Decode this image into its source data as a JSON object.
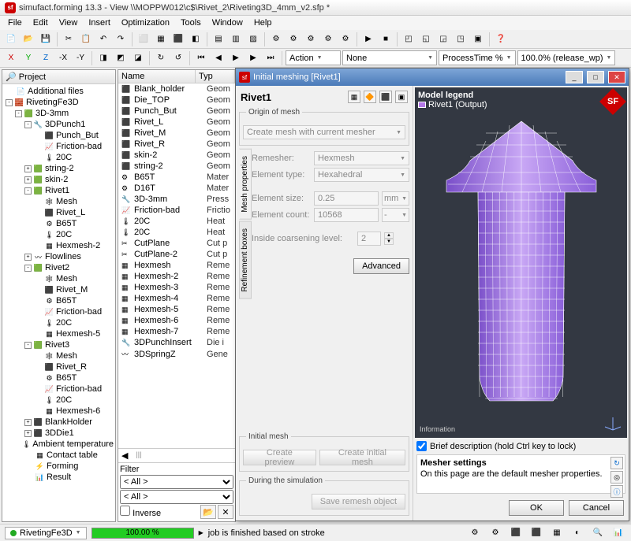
{
  "window": {
    "app": "simufact.forming 13.3",
    "doc": "View \\\\MOPPW012\\c$\\Rivet_2\\Riveting3D_4mm_v2.sfp *"
  },
  "menu": [
    "File",
    "Edit",
    "View",
    "Insert",
    "Optimization",
    "Tools",
    "Window",
    "Help"
  ],
  "toolbar2": {
    "action": "Action",
    "field1": "None",
    "field2": "ProcessTime %",
    "zoom": "100.0% (release_wp)"
  },
  "project": {
    "title": "Project",
    "nodes": [
      {
        "d": 0,
        "tw": "",
        "ic": "📄",
        "t": "Additional files"
      },
      {
        "d": 0,
        "tw": "-",
        "ic": "🧱",
        "t": "RivetingFe3D"
      },
      {
        "d": 1,
        "tw": "-",
        "ic": "🟩",
        "t": "3D-3mm"
      },
      {
        "d": 2,
        "tw": "-",
        "ic": "🔧",
        "t": "3DPunch1"
      },
      {
        "d": 3,
        "tw": "",
        "ic": "⬛",
        "t": "Punch_But"
      },
      {
        "d": 3,
        "tw": "",
        "ic": "📈",
        "t": "Friction-bad"
      },
      {
        "d": 3,
        "tw": "",
        "ic": "🌡",
        "t": "20C"
      },
      {
        "d": 2,
        "tw": "+",
        "ic": "🟩",
        "t": "string-2"
      },
      {
        "d": 2,
        "tw": "+",
        "ic": "🟩",
        "t": "skin-2"
      },
      {
        "d": 2,
        "tw": "-",
        "ic": "🟩",
        "t": "Rivet1"
      },
      {
        "d": 3,
        "tw": "",
        "ic": "🕸",
        "t": "Mesh"
      },
      {
        "d": 3,
        "tw": "",
        "ic": "⬛",
        "t": "Rivet_L"
      },
      {
        "d": 3,
        "tw": "",
        "ic": "⚙",
        "t": "B65T"
      },
      {
        "d": 3,
        "tw": "",
        "ic": "🌡",
        "t": "20C"
      },
      {
        "d": 3,
        "tw": "",
        "ic": "▦",
        "t": "Hexmesh-2"
      },
      {
        "d": 2,
        "tw": "+",
        "ic": "〰",
        "t": "Flowlines"
      },
      {
        "d": 2,
        "tw": "-",
        "ic": "🟩",
        "t": "Rivet2"
      },
      {
        "d": 3,
        "tw": "",
        "ic": "🕸",
        "t": "Mesh"
      },
      {
        "d": 3,
        "tw": "",
        "ic": "⬛",
        "t": "Rivet_M"
      },
      {
        "d": 3,
        "tw": "",
        "ic": "⚙",
        "t": "B65T"
      },
      {
        "d": 3,
        "tw": "",
        "ic": "📈",
        "t": "Friction-bad"
      },
      {
        "d": 3,
        "tw": "",
        "ic": "🌡",
        "t": "20C"
      },
      {
        "d": 3,
        "tw": "",
        "ic": "▦",
        "t": "Hexmesh-5"
      },
      {
        "d": 2,
        "tw": "-",
        "ic": "🟩",
        "t": "Rivet3"
      },
      {
        "d": 3,
        "tw": "",
        "ic": "🕸",
        "t": "Mesh"
      },
      {
        "d": 3,
        "tw": "",
        "ic": "⬛",
        "t": "Rivet_R"
      },
      {
        "d": 3,
        "tw": "",
        "ic": "⚙",
        "t": "B65T"
      },
      {
        "d": 3,
        "tw": "",
        "ic": "📈",
        "t": "Friction-bad"
      },
      {
        "d": 3,
        "tw": "",
        "ic": "🌡",
        "t": "20C"
      },
      {
        "d": 3,
        "tw": "",
        "ic": "▦",
        "t": "Hexmesh-6"
      },
      {
        "d": 2,
        "tw": "+",
        "ic": "⬛",
        "t": "BlankHolder"
      },
      {
        "d": 2,
        "tw": "+",
        "ic": "⬛",
        "t": "3DDie1"
      },
      {
        "d": 2,
        "tw": "",
        "ic": "🌡",
        "t": "Ambient temperature"
      },
      {
        "d": 2,
        "tw": "",
        "ic": "▦",
        "t": "Contact table"
      },
      {
        "d": 2,
        "tw": "",
        "ic": "⚡",
        "t": "Forming"
      },
      {
        "d": 2,
        "tw": "",
        "ic": "📊",
        "t": "Result"
      }
    ]
  },
  "list": {
    "cols": [
      "Name",
      "Typ"
    ],
    "rows": [
      {
        "ic": "⬛",
        "n": "Blank_holder",
        "t": "Geom"
      },
      {
        "ic": "⬛",
        "n": "Die_TOP",
        "t": "Geom"
      },
      {
        "ic": "⬛",
        "n": "Punch_But",
        "t": "Geom"
      },
      {
        "ic": "⬛",
        "n": "Rivet_L",
        "t": "Geom"
      },
      {
        "ic": "⬛",
        "n": "Rivet_M",
        "t": "Geom"
      },
      {
        "ic": "⬛",
        "n": "Rivet_R",
        "t": "Geom"
      },
      {
        "ic": "⬛",
        "n": "skin-2",
        "t": "Geom"
      },
      {
        "ic": "⬛",
        "n": "string-2",
        "t": "Geom"
      },
      {
        "ic": "⚙",
        "n": "B65T",
        "t": "Mater"
      },
      {
        "ic": "⚙",
        "n": "D16T",
        "t": "Mater"
      },
      {
        "ic": "🔧",
        "n": "3D-3mm",
        "t": "Press"
      },
      {
        "ic": "📈",
        "n": "Friction-bad",
        "t": "Frictio"
      },
      {
        "ic": "🌡",
        "n": "20C",
        "t": "Heat"
      },
      {
        "ic": "🌡",
        "n": "20C",
        "t": "Heat"
      },
      {
        "ic": "✂",
        "n": "CutPlane",
        "t": "Cut p"
      },
      {
        "ic": "✂",
        "n": "CutPlane-2",
        "t": "Cut p"
      },
      {
        "ic": "▦",
        "n": "Hexmesh",
        "t": "Reme"
      },
      {
        "ic": "▦",
        "n": "Hexmesh-2",
        "t": "Reme"
      },
      {
        "ic": "▦",
        "n": "Hexmesh-3",
        "t": "Reme"
      },
      {
        "ic": "▦",
        "n": "Hexmesh-4",
        "t": "Reme"
      },
      {
        "ic": "▦",
        "n": "Hexmesh-5",
        "t": "Reme"
      },
      {
        "ic": "▦",
        "n": "Hexmesh-6",
        "t": "Reme"
      },
      {
        "ic": "▦",
        "n": "Hexmesh-7",
        "t": "Reme"
      },
      {
        "ic": "🔧",
        "n": "3DPunchInsert",
        "t": "Die i"
      },
      {
        "ic": "〰",
        "n": "3DSpringZ",
        "t": "Gene"
      }
    ],
    "filter": {
      "label": "Filter",
      "all": "< All >",
      "inverse": "Inverse"
    }
  },
  "dialog": {
    "title": "Initial meshing [Rivet1]",
    "object": "Rivet1",
    "origin_grp": "Origin of mesh",
    "origin_val": "Create mesh with current mesher",
    "tabs": [
      "Mesh properties",
      "Refinement boxes"
    ],
    "remesher_l": "Remesher:",
    "remesher_v": "Hexmesh",
    "elemtype_l": "Element type:",
    "elemtype_v": "Hexahedral",
    "elemsize_l": "Element size:",
    "elemsize_v": "0.25",
    "elemsize_u": "mm",
    "elemcnt_l": "Element count:",
    "elemcnt_v": "10568",
    "coarse_l": "Inside coarsening level:",
    "coarse_v": "2",
    "advanced": "Advanced",
    "initial_grp": "Initial mesh",
    "create_prev": "Create preview",
    "create_init": "Create initial mesh",
    "during_grp": "During the simulation",
    "save_remesh": "Save remesh object",
    "legend_title": "Model legend",
    "legend_item": "Rivet1 (Output)",
    "info": "Information",
    "brief": "Brief description (hold Ctrl key to lock)",
    "help_title": "Mesher settings",
    "help_text": "On this page are the default mesher properties.",
    "ok": "OK",
    "cancel": "Cancel"
  },
  "status": {
    "process": "RivetingFe3D",
    "pct": "100.00 %",
    "msg": "job is finished based on stroke"
  }
}
